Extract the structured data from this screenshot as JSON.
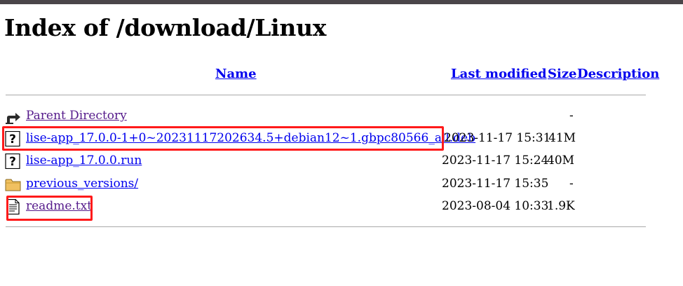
{
  "page": {
    "title": "Index of /download/Linux"
  },
  "columns": {
    "name": "Name",
    "last_modified": "Last modified",
    "size": "Size",
    "description": "Description"
  },
  "entries": [
    {
      "name": "Parent Directory",
      "modified": "",
      "size": "-",
      "icon": "parent-directory-icon",
      "visited": true
    },
    {
      "name": "lise-app_17.0.0-1+0~20231117202634.5+debian12~1.gbpc80566_all.deb",
      "modified": "2023-11-17 15:31",
      "size": "41M",
      "icon": "unknown-file-icon",
      "visited": false
    },
    {
      "name": "lise-app_17.0.0.run",
      "modified": "2023-11-17 15:24",
      "size": "40M",
      "icon": "unknown-file-icon",
      "visited": false
    },
    {
      "name": "previous_versions/",
      "modified": "2023-11-17 15:35",
      "size": "-",
      "icon": "folder-icon",
      "visited": false
    },
    {
      "name": "readme.txt",
      "modified": "2023-08-04 10:33",
      "size": "1.9K",
      "icon": "text-file-icon",
      "visited": true
    }
  ],
  "colors": {
    "link": "#0000ee",
    "visited_link": "#551a8b",
    "highlight": "#ff1a1a",
    "rule": "#a9a9a9"
  }
}
